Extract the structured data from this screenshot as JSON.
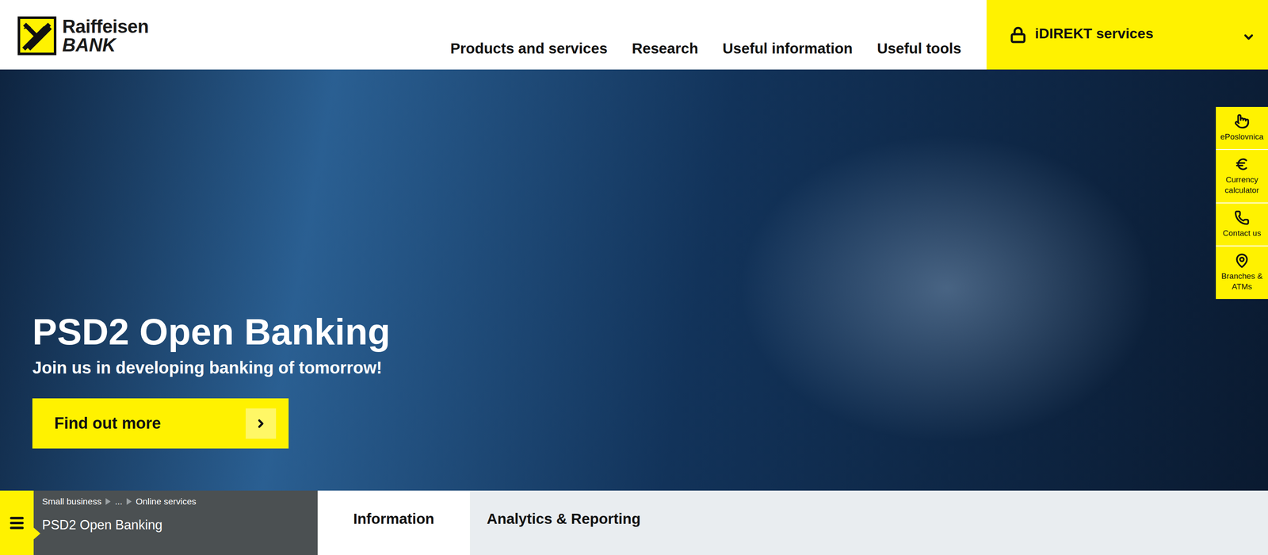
{
  "header": {
    "logo": {
      "line1": "Raiffeisen",
      "line2": "BANK"
    },
    "nav": [
      "Products and services",
      "Research",
      "Useful information",
      "Useful tools"
    ],
    "account_menu": {
      "label": "iDIREKT services"
    }
  },
  "side_tools": [
    {
      "label": "ePoslovnica"
    },
    {
      "label": "Currency calculator"
    },
    {
      "label": "Contact us"
    },
    {
      "label": "Branches & ATMs"
    }
  ],
  "hero": {
    "title": "PSD2 Open Banking",
    "subtitle": "Join us in developing banking of tomorrow!",
    "button": {
      "label": "Find out more"
    }
  },
  "breadcrumb": [
    "Small business",
    "...",
    "Online services"
  ],
  "page_title": "PSD2 Open Banking",
  "tabs": [
    {
      "label": "Information",
      "selected": true
    },
    {
      "label": "Analytics & Reporting",
      "selected": false
    }
  ]
}
